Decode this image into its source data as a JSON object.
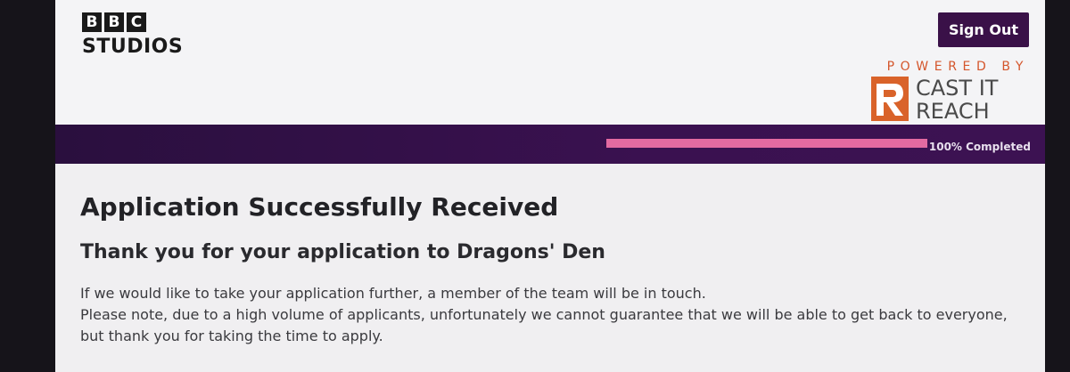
{
  "header": {
    "logo": {
      "blocks": [
        "B",
        "B",
        "C"
      ],
      "subtitle": "STUDIOS"
    },
    "sign_out_label": "Sign Out",
    "powered_by": "POWERED BY",
    "partner_logo": {
      "icon": "cast-it-reach-r-icon",
      "line1": "CAST IT",
      "line2": "REACH"
    }
  },
  "progress": {
    "percent": 100,
    "label": "100% Completed"
  },
  "main": {
    "title": "Application Successfully Received",
    "subtitle": "Thank you for your application to Dragons' Den",
    "paragraph1": "If we would like to take your application further, a member of the team will be in touch.",
    "paragraph2": "Please note, due to a high volume of applicants, unfortunately we cannot guarantee that we will be able to get back to everyone, but thank you for taking the time to apply."
  },
  "colors": {
    "brand_purple": "#3a1148",
    "progress_pink": "#e36aa1",
    "accent_orange": "#d9632a"
  }
}
